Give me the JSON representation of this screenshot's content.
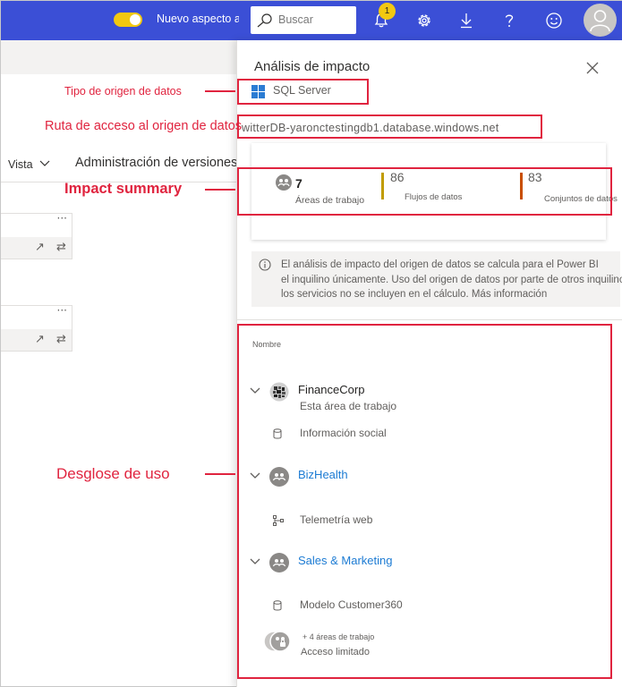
{
  "topbar": {
    "toggle_label": "Nuevo aspecto a",
    "search_placeholder": "Buscar",
    "notification_count": "1"
  },
  "background": {
    "menu_view": "Vista",
    "menu_versions": "Administración de versiones"
  },
  "annotations": {
    "source_type": "Tipo de origen de datos",
    "source_path": "Ruta de acceso al origen de datos",
    "impact_summary": "Impact summary",
    "usage_breakdown": "Desglose de uso"
  },
  "panel": {
    "title": "Análisis de impacto",
    "source_type": "SQL Server",
    "source_path": "witterDB-yaronctestingdb1.database.windows.net",
    "summary": [
      {
        "value": "7",
        "label": "Áreas de trabajo"
      },
      {
        "value": "86",
        "label": "Flujos de datos"
      },
      {
        "value": "83",
        "label": "Conjuntos de datos"
      }
    ],
    "info_lines": [
      "El análisis de impacto del origen de datos se calcula para el Power BI",
      "el inquilino únicamente. Uso del origen de datos por parte de otros inquilinos de",
      "los servicios no se incluyen en el cálculo. Más información"
    ],
    "column_header": "Nombre",
    "workspaces": [
      {
        "name": "FinanceCorp",
        "subtitle": "Esta área de trabajo",
        "artifact": "Información social"
      },
      {
        "name": "BizHealth",
        "artifact": "Telemetría web"
      },
      {
        "name": "Sales & Marketing",
        "artifact": "Modelo Customer360"
      }
    ],
    "more_workspaces": "+ 4 áreas de trabajo",
    "limited_access": "Acceso limitado"
  },
  "colors": {
    "topbar": "#3b4fd6",
    "annotation": "#e0243f",
    "link": "#1c7bd3",
    "bar_workspaces": "#c19c00",
    "bar_flows": "#d58e00",
    "bar_datasets": "#c84e00"
  }
}
